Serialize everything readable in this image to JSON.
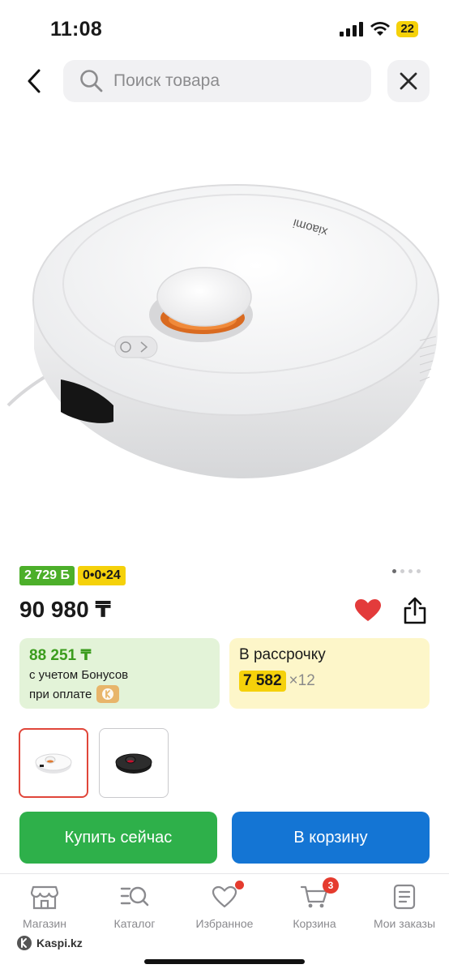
{
  "status_bar": {
    "time": "11:08",
    "battery": "22"
  },
  "header": {
    "search_placeholder": "Поиск товара"
  },
  "product": {
    "brand_text": "xiaomi",
    "bonus_badge": "2 729 Б",
    "installment_badge": "0•0•24",
    "price": "90 980 ₸",
    "bonus_price": "88 251 ₸",
    "bonus_note": "с учетом Бонусов",
    "payment_note": "при оплате",
    "credit_title": "В рассрочку",
    "credit_amount": "7 582",
    "credit_term": "×12",
    "image_pager": {
      "total": 4,
      "active": 1
    }
  },
  "variants": [
    {
      "name": "white",
      "selected": true
    },
    {
      "name": "black",
      "selected": false
    }
  ],
  "actions": {
    "buy_now": "Купить сейчас",
    "add_to_cart": "В корзину"
  },
  "nav": {
    "items": [
      {
        "label": "Магазин",
        "icon": "store-icon"
      },
      {
        "label": "Каталог",
        "icon": "catalog-search-icon"
      },
      {
        "label": "Избранное",
        "icon": "heart-icon"
      },
      {
        "label": "Корзина",
        "icon": "cart-icon",
        "badge": "3"
      },
      {
        "label": "Мои заказы",
        "icon": "orders-icon"
      }
    ]
  },
  "footer": {
    "brand": "Kaspi.kz"
  },
  "colors": {
    "accent_green": "#2eb04a",
    "accent_blue": "#1475d4",
    "kaspi_red": "#e53b2e",
    "yellow": "#f5d10a"
  }
}
